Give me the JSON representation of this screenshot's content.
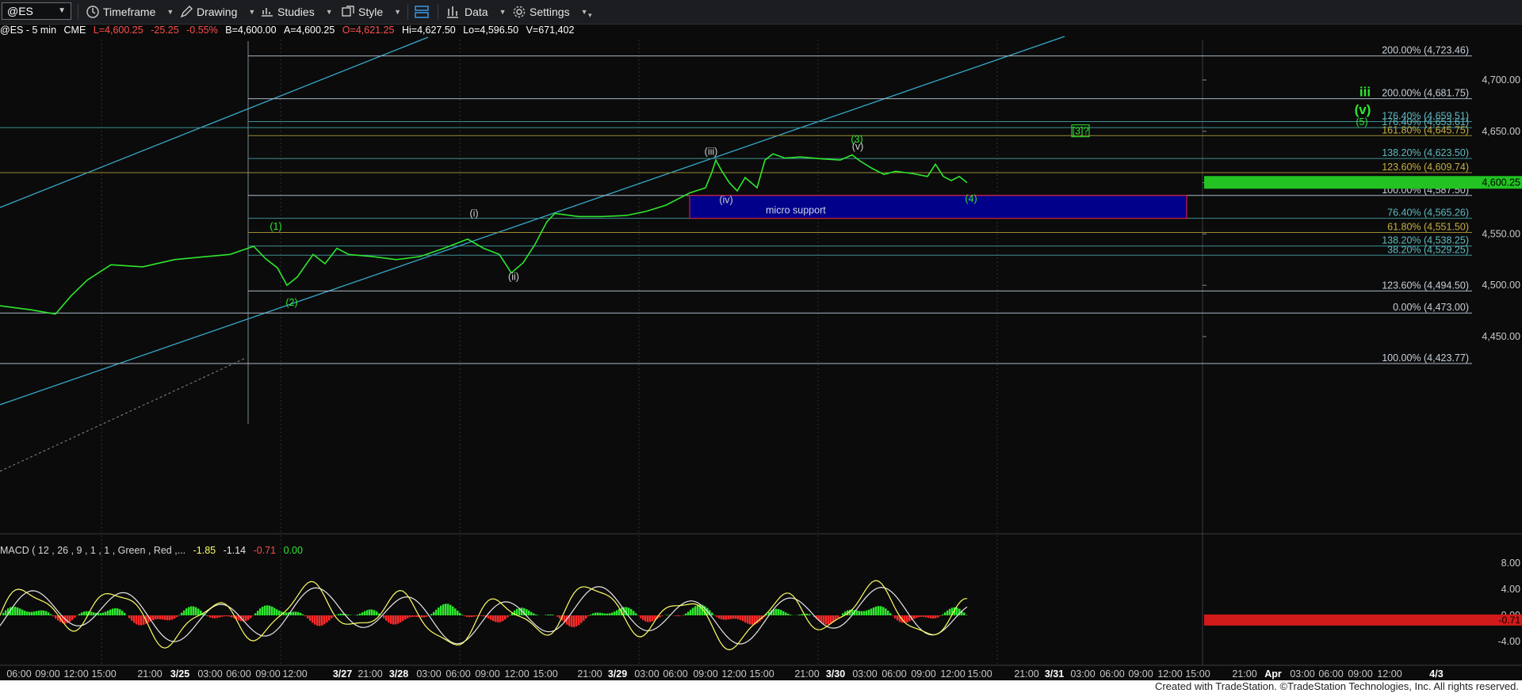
{
  "toolbar": {
    "symbol": "@ES",
    "timeframe": "Timeframe",
    "drawing": "Drawing",
    "studies": "Studies",
    "style": "Style",
    "data": "Data",
    "settings": "Settings"
  },
  "status": {
    "symbol": "@ES - 5 min",
    "exchange": "CME",
    "last": "L=4,600.25",
    "change": "-25.25",
    "pct": "-0.55%",
    "bid": "B=4,600.00",
    "ask": "A=4,600.25",
    "open": "O=4,621.25",
    "high": "Hi=4,627.50",
    "low": "Lo=4,596.50",
    "volume": "V=671,402"
  },
  "colors": {
    "up": "#2ee82e",
    "down": "#ff2a2a",
    "macd": "#ffff66",
    "signal": "#e8e8e8",
    "fib": "#a9b7c6",
    "trend": "#36a9c9",
    "box": "#00008b"
  },
  "chart_data": {
    "type": "line",
    "title": "",
    "price_axis": [
      "4,700.00",
      "4,650.00",
      "4,600.00",
      "4,550.00",
      "4,500.00",
      "4,450.00"
    ],
    "price_ticks": [
      4700,
      4650,
      4600,
      4550,
      4500,
      4450
    ],
    "ylim": [
      4415,
      4735
    ],
    "last_price_label": "4,600.25",
    "last_price": 4600.25,
    "time_axis": [
      "06:00",
      "09:00",
      "12:00",
      "15:00",
      "21:00",
      "3/25",
      "03:00",
      "06:00",
      "09:00",
      "12:00",
      "3/27",
      "21:00",
      "3/28",
      "03:00",
      "06:00",
      "09:00",
      "12:00",
      "15:00",
      "21:00",
      "3/29",
      "03:00",
      "06:00",
      "09:00",
      "12:00",
      "15:00",
      "21:00",
      "3/30",
      "03:00",
      "06:00",
      "09:00",
      "12:00",
      "15:00",
      "21:00",
      "3/31",
      "03:00",
      "06:00",
      "09:00",
      "12:00",
      "15:00",
      "21:00",
      "Apr",
      "03:00",
      "06:00",
      "09:00",
      "12:00",
      "4/3"
    ],
    "fib_levels": [
      {
        "label": "200.00% (4,723.46)",
        "value": 4723.46
      },
      {
        "label": "200.00% (4,681.75)",
        "value": 4681.75
      },
      {
        "label": "176.40% (4,659.51)",
        "value": 4659.51
      },
      {
        "label": "176.40% (4,653.61)",
        "value": 4653.61
      },
      {
        "label": "161.80% (4,645.75)",
        "value": 4645.75
      },
      {
        "label": "138.20% (4,623.50)",
        "value": 4623.5
      },
      {
        "label": "123.60% (4,609.74)",
        "value": 4609.74
      },
      {
        "label": "100.00% (4,587.50)",
        "value": 4587.5
      },
      {
        "label": "76.40% (4,565.26)",
        "value": 4565.26
      },
      {
        "label": "61.80% (4,551.50)",
        "value": 4551.5
      },
      {
        "label": "138.20% (4,538.25)",
        "value": 4538.25
      },
      {
        "label": "38.20% (4,529.25)",
        "value": 4529.25
      },
      {
        "label": "123.60% (4,494.50)",
        "value": 4494.5
      },
      {
        "label": "0.00% (4,473.00)",
        "value": 4473.0
      },
      {
        "label": "100.00% (4,423.77)",
        "value": 4423.77
      }
    ],
    "price_series": [
      [
        0,
        4480
      ],
      [
        40,
        4476
      ],
      [
        70,
        4472
      ],
      [
        90,
        4490
      ],
      [
        110,
        4505
      ],
      [
        140,
        4520
      ],
      [
        180,
        4518
      ],
      [
        220,
        4525
      ],
      [
        260,
        4528
      ],
      [
        290,
        4530
      ],
      [
        305,
        4534
      ],
      [
        320,
        4538
      ],
      [
        335,
        4526
      ],
      [
        350,
        4517
      ],
      [
        362,
        4500
      ],
      [
        375,
        4508
      ],
      [
        395,
        4530
      ],
      [
        410,
        4521
      ],
      [
        425,
        4536
      ],
      [
        440,
        4530
      ],
      [
        470,
        4528
      ],
      [
        500,
        4525
      ],
      [
        530,
        4528
      ],
      [
        560,
        4536
      ],
      [
        590,
        4545
      ],
      [
        610,
        4536
      ],
      [
        630,
        4530
      ],
      [
        645,
        4512
      ],
      [
        660,
        4522
      ],
      [
        675,
        4540
      ],
      [
        690,
        4562
      ],
      [
        700,
        4570
      ],
      [
        730,
        4567
      ],
      [
        760,
        4567
      ],
      [
        790,
        4568
      ],
      [
        815,
        4572
      ],
      [
        840,
        4578
      ],
      [
        870,
        4590
      ],
      [
        890,
        4595
      ],
      [
        898,
        4610
      ],
      [
        903,
        4622
      ],
      [
        910,
        4612
      ],
      [
        920,
        4600
      ],
      [
        930,
        4592
      ],
      [
        940,
        4605
      ],
      [
        955,
        4595
      ],
      [
        965,
        4622
      ],
      [
        975,
        4628
      ],
      [
        990,
        4624
      ],
      [
        1010,
        4625
      ],
      [
        1040,
        4623
      ],
      [
        1060,
        4622
      ],
      [
        1075,
        4627
      ],
      [
        1085,
        4621
      ],
      [
        1100,
        4614
      ],
      [
        1115,
        4608
      ],
      [
        1130,
        4611
      ],
      [
        1150,
        4609
      ],
      [
        1170,
        4606
      ],
      [
        1180,
        4618
      ],
      [
        1190,
        4606
      ],
      [
        1200,
        4602
      ],
      [
        1210,
        4606
      ],
      [
        1220,
        4600
      ]
    ],
    "wave_labels": [
      {
        "text": "(1)",
        "price": 4554,
        "color": "#2ee82e"
      },
      {
        "text": "(2)",
        "price": 4480,
        "color": "#2ee82e"
      },
      {
        "text": "(i)",
        "price": 4567,
        "color": "#d0d0d0"
      },
      {
        "text": "(ii)",
        "price": 4505,
        "color": "#d0d0d0"
      },
      {
        "text": "(iii)",
        "price": 4627,
        "color": "#d0d0d0"
      },
      {
        "text": "(iv)",
        "price": 4580,
        "color": "#d0d0d0"
      },
      {
        "text": "(3)",
        "price": 4639,
        "color": "#2ee82e"
      },
      {
        "text": "(v)",
        "price": 4632,
        "color": "#d0d0d0"
      },
      {
        "text": "(4)",
        "price": 4581,
        "color": "#2ee82e"
      },
      {
        "text": "[3]?",
        "price": 4647,
        "color": "#2ee82e"
      },
      {
        "text": "iii",
        "price": 4684,
        "color": "#2ee82e"
      },
      {
        "text": "(v)",
        "price": 4667,
        "color": "#2ee82e"
      },
      {
        "text": "(5)",
        "price": 4656,
        "color": "#2ee82e"
      }
    ],
    "annotation": "micro support",
    "zone": {
      "low": 4565.26,
      "high": 4587.5
    }
  },
  "macd": {
    "label": "MACD ( 12 , 26 , 9 , 1 , 1 , Green , Red ,...",
    "values": [
      "-1.85",
      "-1.14",
      "-0.71",
      "0.00"
    ],
    "axis": [
      "8.00",
      "4.00",
      "0.00",
      "-4.00"
    ],
    "axis_values": [
      8,
      4,
      0,
      -4
    ],
    "last_label": "-0.71"
  },
  "credit": "Created with TradeStation. ©TradeStation Technologies, Inc. All rights reserved."
}
